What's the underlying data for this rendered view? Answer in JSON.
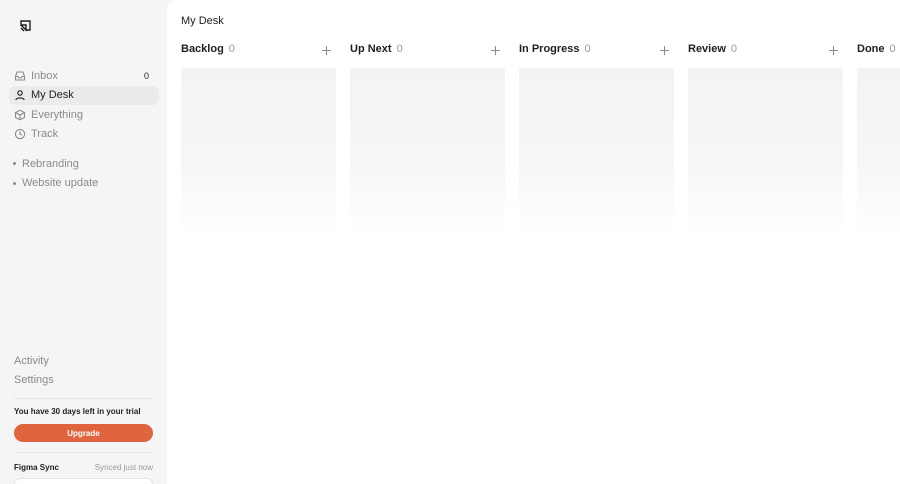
{
  "sidebar": {
    "logo": "app-logo",
    "nav": [
      {
        "label": "Inbox",
        "icon": "inbox-icon",
        "count": "0"
      },
      {
        "label": "My Desk",
        "icon": "user-icon"
      },
      {
        "label": "Everything",
        "icon": "cube-icon"
      },
      {
        "label": "Track",
        "icon": "clock-icon"
      }
    ],
    "projects": [
      "Rebranding",
      "Website update"
    ],
    "bottom": [
      "Activity",
      "Settings"
    ],
    "trial_text": "You have 30 days left in your trial",
    "upgrade_label": "Upgrade",
    "sync_label": "Figma Sync",
    "sync_status": "Synced just now"
  },
  "main": {
    "title": "My Desk",
    "columns": [
      {
        "name": "Backlog",
        "count": "0"
      },
      {
        "name": "Up Next",
        "count": "0"
      },
      {
        "name": "In Progress",
        "count": "0"
      },
      {
        "name": "Review",
        "count": "0"
      },
      {
        "name": "Done",
        "count": "0"
      }
    ]
  },
  "colors": {
    "accent": "#e0653e",
    "sidebar_bg": "#f5f5f5",
    "main_bg": "#ffffff"
  }
}
